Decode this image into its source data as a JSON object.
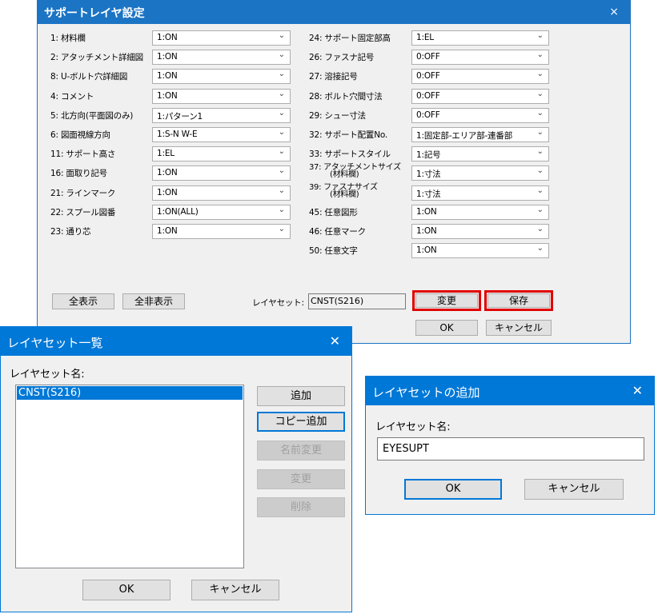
{
  "main_dialog": {
    "title": "サポートレイヤ設定",
    "close_glyph": "×",
    "left_rows": [
      {
        "label": "1: 材料欄",
        "value": "1:ON"
      },
      {
        "label": "2: アタッチメント詳細図",
        "value": "1:ON"
      },
      {
        "label": "8: U-ボルト穴詳細図",
        "value": "1:ON"
      },
      {
        "label": "4: コメント",
        "value": "1:ON"
      },
      {
        "label": "5: 北方向(平面図のみ)",
        "value": "1:パターン1"
      },
      {
        "label": "6: 図面視線方向",
        "value": "1:S-N W-E"
      },
      {
        "label": "11: サポート高さ",
        "value": "1:EL"
      },
      {
        "label": "16: 面取り記号",
        "value": "1:ON"
      },
      {
        "label": "21: ラインマーク",
        "value": "1:ON"
      },
      {
        "label": "22: スプール図番",
        "value": "1:ON(ALL)"
      },
      {
        "label": "23: 通り芯",
        "value": "1:ON"
      }
    ],
    "right_rows": [
      {
        "label": "24: サポート固定部高",
        "value": "1:EL"
      },
      {
        "label": "26: ファスナ記号",
        "value": "0:OFF"
      },
      {
        "label": "27: 溶接記号",
        "value": "0:OFF"
      },
      {
        "label": "28: ボルト穴間寸法",
        "value": "0:OFF"
      },
      {
        "label": "29: シュー寸法",
        "value": "0:OFF"
      },
      {
        "label": "32: サポート配置No.",
        "value": "1:固定部-エリア部-連番部"
      },
      {
        "label": "33: サポートスタイル",
        "value": "1:記号"
      },
      {
        "label": "37: アタッチメントサイズ",
        "label_line2": "(材料欄)",
        "value": "1:寸法"
      },
      {
        "label": "39: ファスナサイズ",
        "label_line2": "(材料欄)",
        "value": "1:寸法"
      },
      {
        "label": "45: 任意図形",
        "value": "1:ON"
      },
      {
        "label": "46: 任意マーク",
        "value": "1:ON"
      },
      {
        "label": "50: 任意文字",
        "value": "1:ON"
      }
    ],
    "show_all_label": "全表示",
    "hide_all_label": "全非表示",
    "layerset_label": "レイヤセット:",
    "layerset_value": "CNST(S216)",
    "change_label": "変更",
    "save_label": "保存",
    "ok_label": "OK",
    "cancel_label": "キャンセル",
    "highlight_color": "#e00000"
  },
  "list_dialog": {
    "title": "レイヤセット一覧",
    "close_glyph": "✕",
    "name_label": "レイヤセット名:",
    "items": [
      "CNST(S216)"
    ],
    "add_label": "追加",
    "copy_add_label": "コピー追加",
    "rename_label": "名前変更",
    "change_label": "変更",
    "delete_label": "削除",
    "ok_label": "OK",
    "cancel_label": "キャンセル"
  },
  "add_dialog": {
    "title": "レイヤセットの追加",
    "close_glyph": "✕",
    "name_label": "レイヤセット名:",
    "name_value": "EYESUPT",
    "ok_label": "OK",
    "cancel_label": "キャンセル"
  },
  "colors": {
    "main_title": "#1b74c4",
    "sub_title": "#0078d7",
    "selection": "#0078d7"
  }
}
